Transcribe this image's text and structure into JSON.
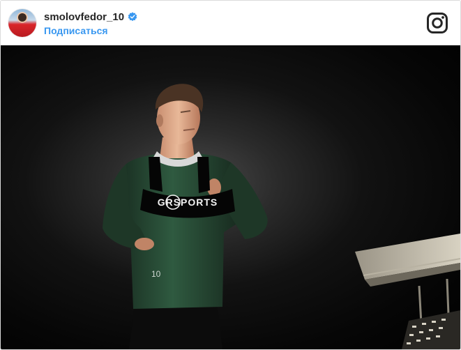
{
  "post": {
    "username": "smolovfedor_10",
    "follow_label": "Подписаться",
    "verified": true,
    "avatar_icon": "profile-avatar",
    "logo_icon": "instagram-icon",
    "photo": {
      "vest_text": "GRSPORTS",
      "jersey_number": "10"
    }
  },
  "colors": {
    "follow": "#3897f0",
    "verified_badge": "#3897f0",
    "username": "#262626"
  }
}
